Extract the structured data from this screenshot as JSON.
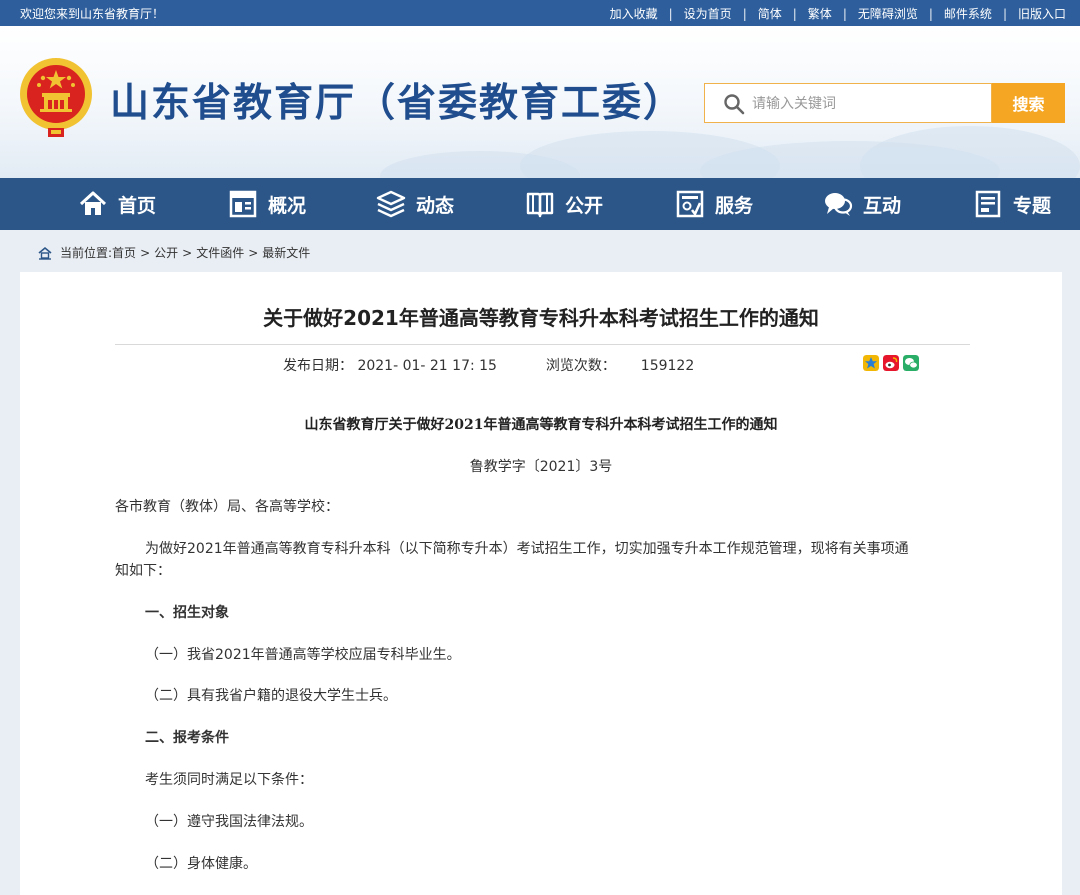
{
  "topbar": {
    "welcome": "欢迎您来到山东省教育厅！",
    "links": [
      "加入收藏",
      "设为首页",
      "简体",
      "繁体",
      "无障碍浏览",
      "邮件系统",
      "旧版入口"
    ],
    "separator": "|"
  },
  "header": {
    "site_title": "山东省教育厅（省委教育工委）",
    "search_placeholder": "请输入关键词",
    "search_button": "搜索"
  },
  "nav": {
    "items": [
      {
        "label": "首页",
        "icon": "home-icon"
      },
      {
        "label": "概况",
        "icon": "overview-icon"
      },
      {
        "label": "动态",
        "icon": "news-stack-icon"
      },
      {
        "label": "公开",
        "icon": "book-icon"
      },
      {
        "label": "服务",
        "icon": "service-icon"
      },
      {
        "label": "互动",
        "icon": "chat-icon"
      },
      {
        "label": "专题",
        "icon": "topic-icon"
      }
    ]
  },
  "breadcrumb": {
    "prefix": "当前位置:",
    "items": [
      "首页",
      "公开",
      "文件函件",
      "最新文件"
    ],
    "arrow": ">"
  },
  "article": {
    "title": "关于做好2021年普通高等教育专科升本科考试招生工作的通知",
    "date_label": "发布日期：",
    "date_value": "2021- 01- 21 17: 15",
    "views_label": "浏览次数：",
    "views_value": "159122",
    "share_icons": [
      "qzone-icon",
      "weibo-icon",
      "wechat-icon"
    ],
    "doc_title": "山东省教育厅关于做好2021年普通高等教育专科升本科考试招生工作的通知",
    "doc_number": "鲁教学字〔2021〕3号",
    "salutation": "各市教育（教体）局、各高等学校：",
    "intro_line1": "为做好2021年普通高等教育专科升本科（以下简称专升本）考试招生工作，切实加强专升本工作规范管理，现将有关事项通",
    "intro_line2": "知如下：",
    "section1": "一、招生对象",
    "s1_item1": "（一）我省2021年普通高等学校应届专科毕业生。",
    "s1_item2": "（二）具有我省户籍的退役大学生士兵。",
    "section2": "二、报考条件",
    "s2_intro": "考生须同时满足以下条件：",
    "s2_item1": "（一）遵守我国法律法规。",
    "s2_item2": "（二）身体健康。"
  },
  "colors": {
    "topbar": "#2e5f9c",
    "nav": "#2c5688",
    "title_blue": "#1f4d8e",
    "search_button": "#f5a623",
    "search_border": "#f0b24a",
    "emblem_red": "#d8231f",
    "emblem_gold": "#f1c232"
  }
}
